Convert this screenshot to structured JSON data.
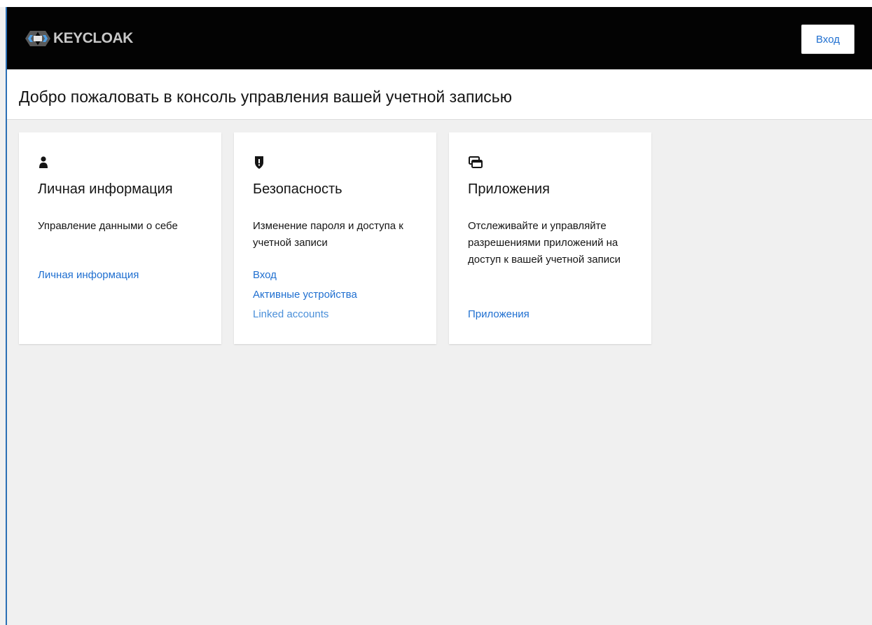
{
  "header": {
    "brand": "KEYCLOAK",
    "login_label": "Вход",
    "colors": {
      "background": "#030303",
      "accent": "#1f6fd0"
    }
  },
  "welcome": {
    "title": "Добро пожаловать в консоль управления вашей учетной записью"
  },
  "cards": [
    {
      "icon": "user-icon",
      "title": "Личная информация",
      "description": "Управление данными о себе",
      "links": [
        "Личная информация"
      ]
    },
    {
      "icon": "shield-icon",
      "title": "Безопасность",
      "description": "Изменение пароля и доступа к учетной записи",
      "links": [
        "Вход",
        "Активные устройства",
        "Linked accounts"
      ]
    },
    {
      "icon": "applications-icon",
      "title": "Приложения",
      "description": "Отслеживайте и управляйте разрешениями приложений на доступ к вашей учетной записи",
      "links": [
        "Приложения"
      ]
    }
  ]
}
